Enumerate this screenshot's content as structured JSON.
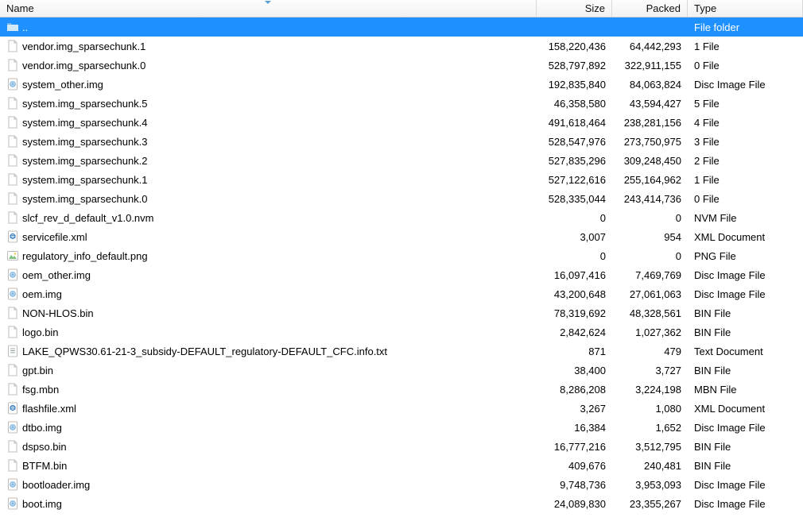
{
  "columns": {
    "name": "Name",
    "size": "Size",
    "packed": "Packed",
    "type": "Type"
  },
  "rows": [
    {
      "icon": "folder-up",
      "name": "..",
      "size": "",
      "packed": "",
      "type": "File folder",
      "selected": true
    },
    {
      "icon": "file",
      "name": "vendor.img_sparsechunk.1",
      "size": "158,220,436",
      "packed": "64,442,293",
      "type": "1 File"
    },
    {
      "icon": "file",
      "name": "vendor.img_sparsechunk.0",
      "size": "528,797,892",
      "packed": "322,911,155",
      "type": "0 File"
    },
    {
      "icon": "disc",
      "name": "system_other.img",
      "size": "192,835,840",
      "packed": "84,063,824",
      "type": "Disc Image File"
    },
    {
      "icon": "file",
      "name": "system.img_sparsechunk.5",
      "size": "46,358,580",
      "packed": "43,594,427",
      "type": "5 File"
    },
    {
      "icon": "file",
      "name": "system.img_sparsechunk.4",
      "size": "491,618,464",
      "packed": "238,281,156",
      "type": "4 File"
    },
    {
      "icon": "file",
      "name": "system.img_sparsechunk.3",
      "size": "528,547,976",
      "packed": "273,750,975",
      "type": "3 File"
    },
    {
      "icon": "file",
      "name": "system.img_sparsechunk.2",
      "size": "527,835,296",
      "packed": "309,248,450",
      "type": "2 File"
    },
    {
      "icon": "file",
      "name": "system.img_sparsechunk.1",
      "size": "527,122,616",
      "packed": "255,164,962",
      "type": "1 File"
    },
    {
      "icon": "file",
      "name": "system.img_sparsechunk.0",
      "size": "528,335,044",
      "packed": "243,414,736",
      "type": "0 File"
    },
    {
      "icon": "file",
      "name": "slcf_rev_d_default_v1.0.nvm",
      "size": "0",
      "packed": "0",
      "type": "NVM File"
    },
    {
      "icon": "xml",
      "name": "servicefile.xml",
      "size": "3,007",
      "packed": "954",
      "type": "XML Document"
    },
    {
      "icon": "image",
      "name": "regulatory_info_default.png",
      "size": "0",
      "packed": "0",
      "type": "PNG File"
    },
    {
      "icon": "disc",
      "name": "oem_other.img",
      "size": "16,097,416",
      "packed": "7,469,769",
      "type": "Disc Image File"
    },
    {
      "icon": "disc",
      "name": "oem.img",
      "size": "43,200,648",
      "packed": "27,061,063",
      "type": "Disc Image File"
    },
    {
      "icon": "file",
      "name": "NON-HLOS.bin",
      "size": "78,319,692",
      "packed": "48,328,561",
      "type": "BIN File"
    },
    {
      "icon": "file",
      "name": "logo.bin",
      "size": "2,842,624",
      "packed": "1,027,362",
      "type": "BIN File"
    },
    {
      "icon": "text",
      "name": "LAKE_QPWS30.61-21-3_subsidy-DEFAULT_regulatory-DEFAULT_CFC.info.txt",
      "size": "871",
      "packed": "479",
      "type": "Text Document"
    },
    {
      "icon": "file",
      "name": "gpt.bin",
      "size": "38,400",
      "packed": "3,727",
      "type": "BIN File"
    },
    {
      "icon": "file",
      "name": "fsg.mbn",
      "size": "8,286,208",
      "packed": "3,224,198",
      "type": "MBN File"
    },
    {
      "icon": "xml",
      "name": "flashfile.xml",
      "size": "3,267",
      "packed": "1,080",
      "type": "XML Document"
    },
    {
      "icon": "disc",
      "name": "dtbo.img",
      "size": "16,384",
      "packed": "1,652",
      "type": "Disc Image File"
    },
    {
      "icon": "file",
      "name": "dspso.bin",
      "size": "16,777,216",
      "packed": "3,512,795",
      "type": "BIN File"
    },
    {
      "icon": "file",
      "name": "BTFM.bin",
      "size": "409,676",
      "packed": "240,481",
      "type": "BIN File"
    },
    {
      "icon": "disc",
      "name": "bootloader.img",
      "size": "9,748,736",
      "packed": "3,953,093",
      "type": "Disc Image File"
    },
    {
      "icon": "disc",
      "name": "boot.img",
      "size": "24,089,830",
      "packed": "23,355,267",
      "type": "Disc Image File"
    }
  ]
}
